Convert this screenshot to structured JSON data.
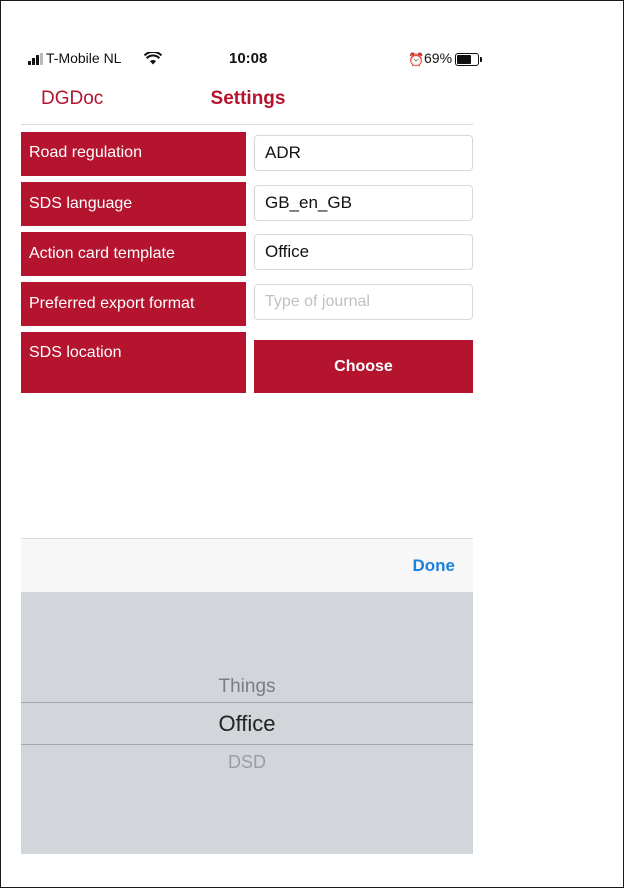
{
  "status_bar": {
    "carrier": "T-Mobile NL",
    "time": "10:08",
    "battery": "69%",
    "battery_level": 0.69
  },
  "nav": {
    "back_label": "DGDoc",
    "title": "Settings"
  },
  "settings": [
    {
      "label": "Road regulation",
      "value": "ADR"
    },
    {
      "label": "SDS language",
      "value": "GB_en_GB"
    },
    {
      "label": "Action card template",
      "value": "Office"
    },
    {
      "label": "Preferred export format",
      "value": "",
      "placeholder": "Type of journal"
    },
    {
      "label": "SDS location",
      "button": "Choose"
    }
  ],
  "picker": {
    "done_label": "Done",
    "options": [
      "Things",
      "Office",
      "DSD"
    ],
    "selected": "Office"
  },
  "colors": {
    "accent": "#b5142f",
    "link": "#1a82d9",
    "picker_bg": "#d2d5da"
  }
}
